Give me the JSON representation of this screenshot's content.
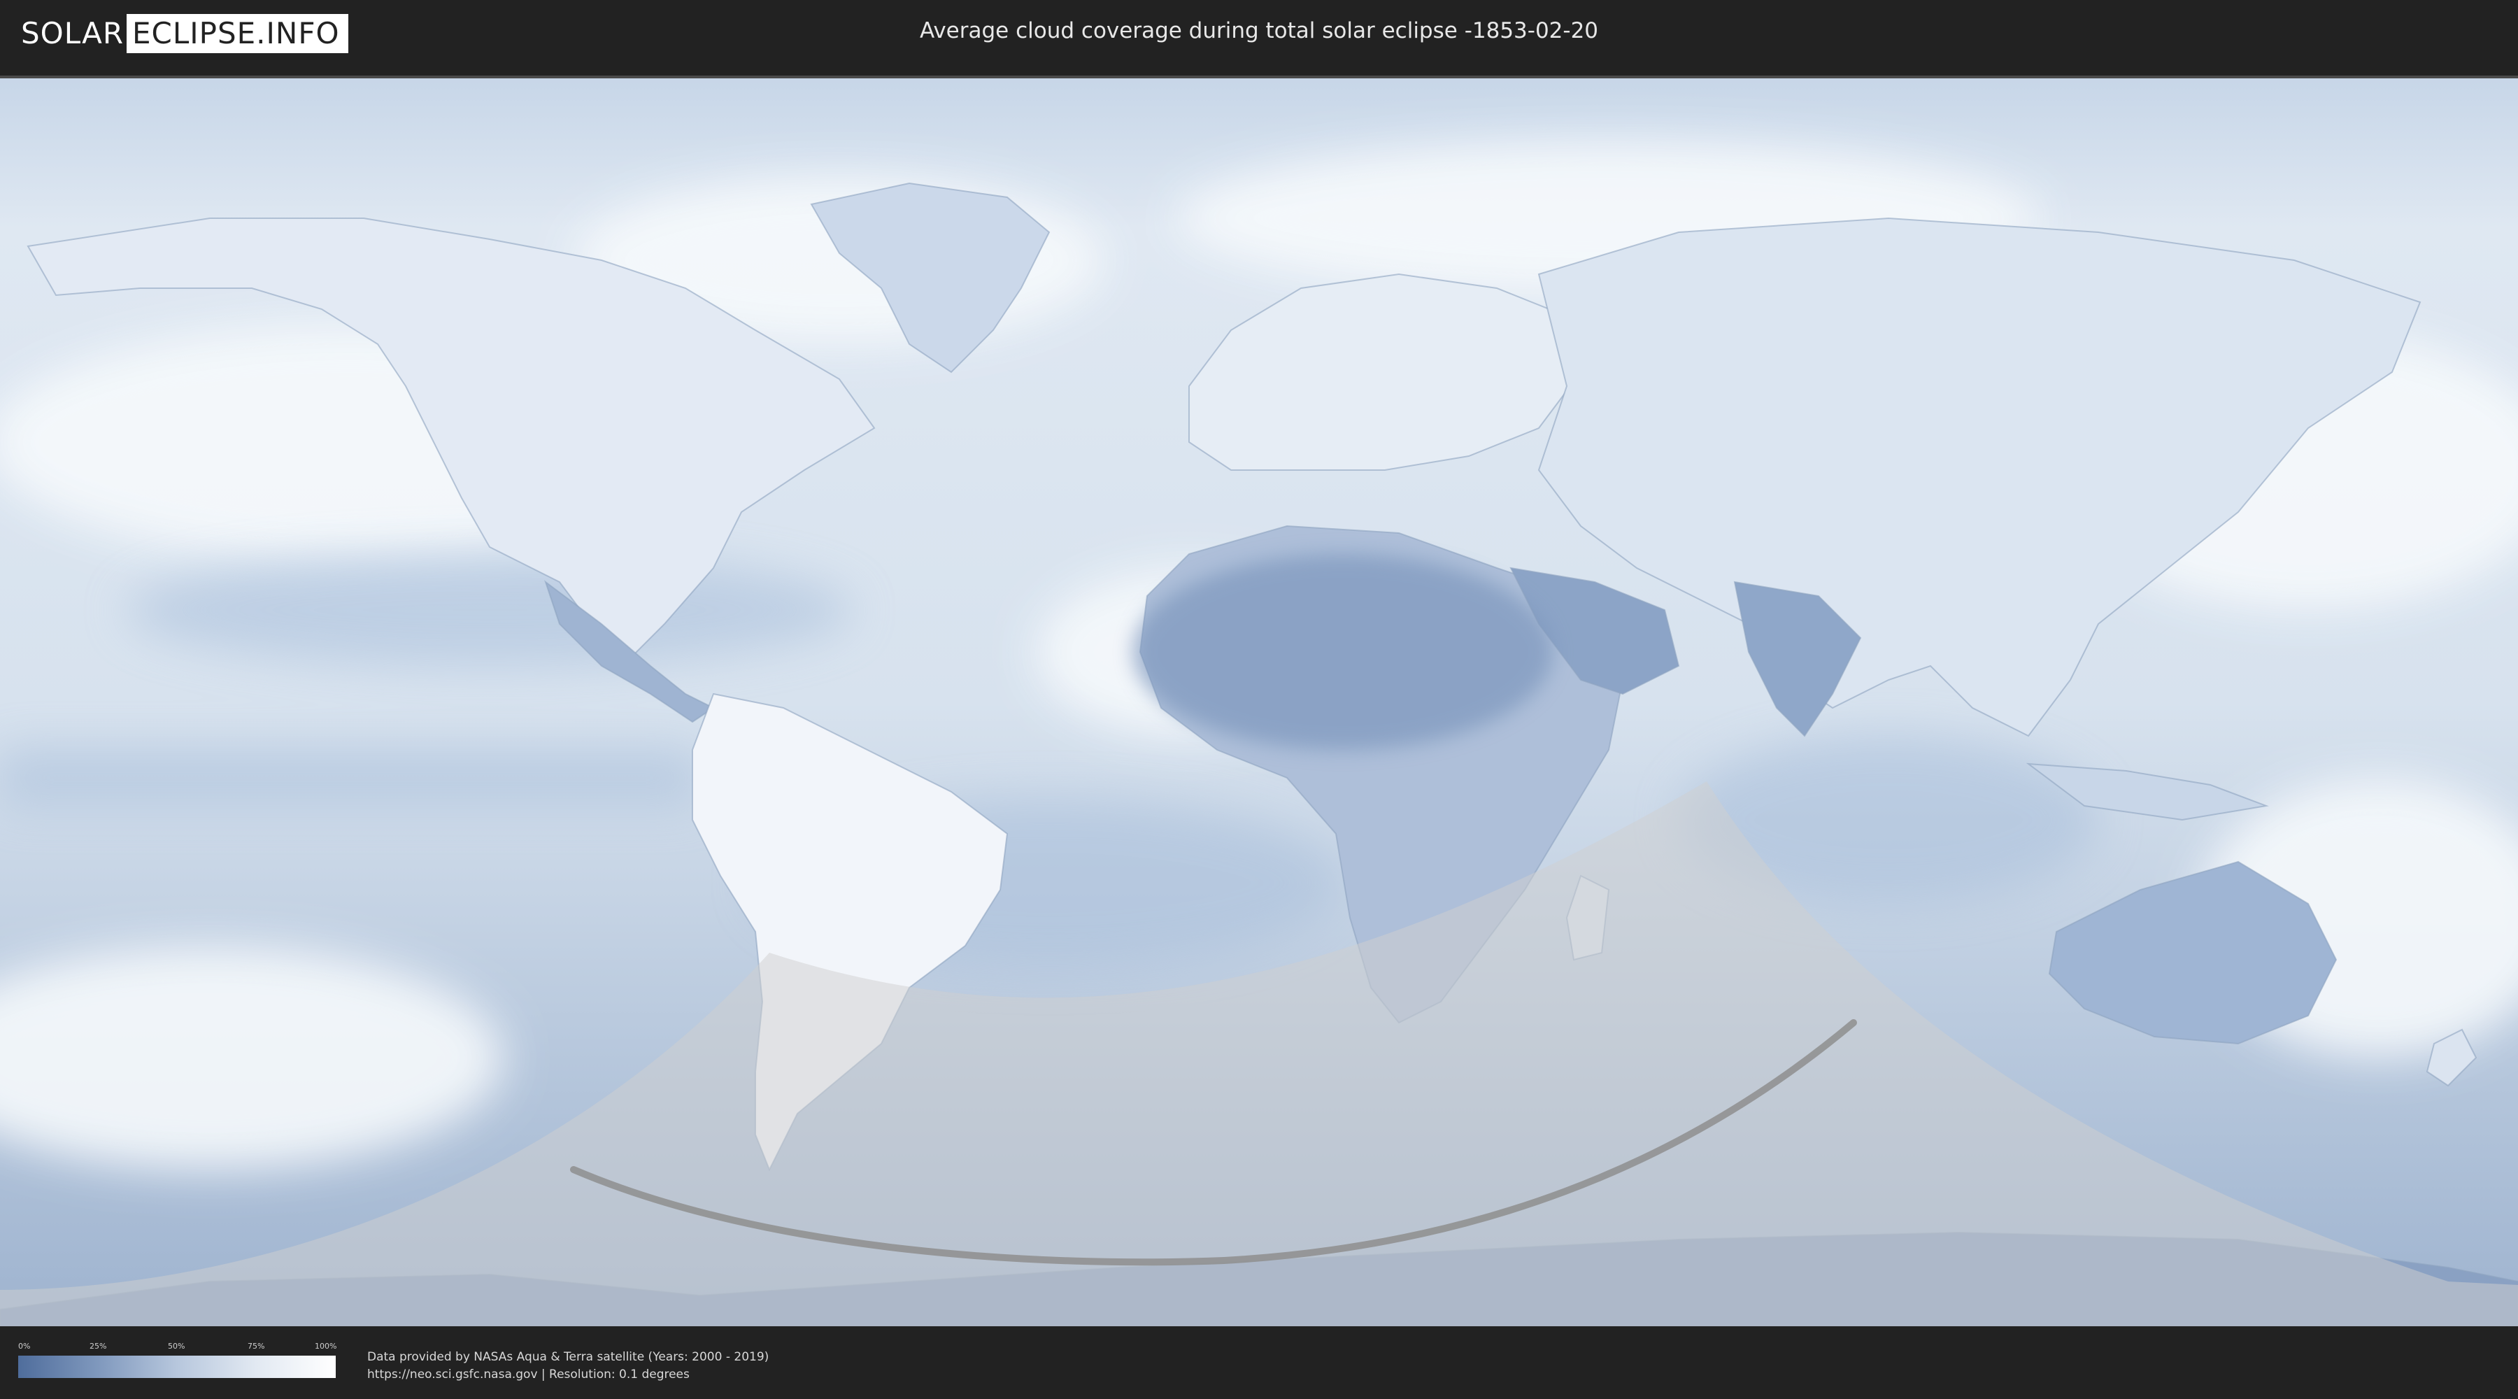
{
  "header": {
    "logo_solar": "SOLAR",
    "logo_rest": "ECLIPSE.INFO",
    "title": "Average cloud coverage during total solar eclipse -1853-02-20"
  },
  "map": {
    "ocean_color": "#d9e4f0",
    "land_color": "#b9cbe2",
    "dry_region_color": "#7d97bd",
    "cloud_color": "#f4f7fb",
    "shadow_overlay_color": "#c9c9c9",
    "path_color": "#8e8e8e"
  },
  "legend": {
    "ticks": [
      "0%",
      "25%",
      "50%",
      "75%",
      "100%"
    ],
    "gradient_colors": [
      "#4f6d9c",
      "#ffffff"
    ]
  },
  "credits": {
    "line1": "Data provided by NASAs Aqua & Terra satellite (Years: 2000 - 2019)",
    "line2": "https://neo.sci.gsfc.nasa.gov | Resolution: 0.1 degrees"
  }
}
